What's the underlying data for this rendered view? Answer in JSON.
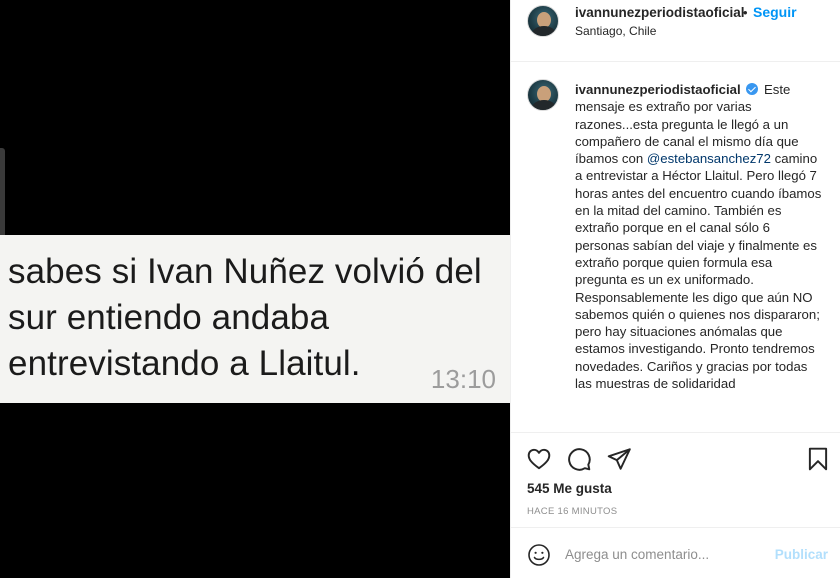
{
  "media": {
    "message": "sabes si Ivan Nuñez volvió del\nsur entiendo andaba\nentrevistando a Llaitul.",
    "time": "13:10"
  },
  "post": {
    "username": "ivannunezperiodistaoficial",
    "dot": "•",
    "follow_label": "Seguir",
    "location": "Santiago, Chile"
  },
  "caption": {
    "username": "ivannunezperiodistaoficial",
    "text_1": "Este mensaje es extraño por varias razones...esta pregunta le llegó a un compañero de canal el mismo día que íbamos con",
    "mention": "@estebansanchez72",
    "text_2": "camino a entrevistar a Héctor Llaitul. Pero llegó 7 horas antes del encuentro cuando íbamos en la mitad del camino. También es extraño porque en el canal sólo 6 personas sabían del viaje y finalmente es extraño porque quien formula esa pregunta es un ex uniformado. Responsablemente les digo que aún NO sabemos quién o quienes nos dispararon; pero hay situaciones anómalas que estamos investigando. Pronto tendremos novedades. Cariños y gracias por todas las muestras de solidaridad"
  },
  "actions": {
    "icons": [
      "heart-icon",
      "comment-icon",
      "share-icon",
      "bookmark-icon"
    ],
    "likes": "545 Me gusta",
    "time_ago": "HACE 16 MINUTOS"
  },
  "comment": {
    "placeholder": "Agrega un comentario...",
    "post_label": "Publicar"
  },
  "colors": {
    "accent": "#0095f6",
    "post_disabled": "#b2dffc",
    "mention": "#00376b",
    "verified": "#3897f0"
  }
}
